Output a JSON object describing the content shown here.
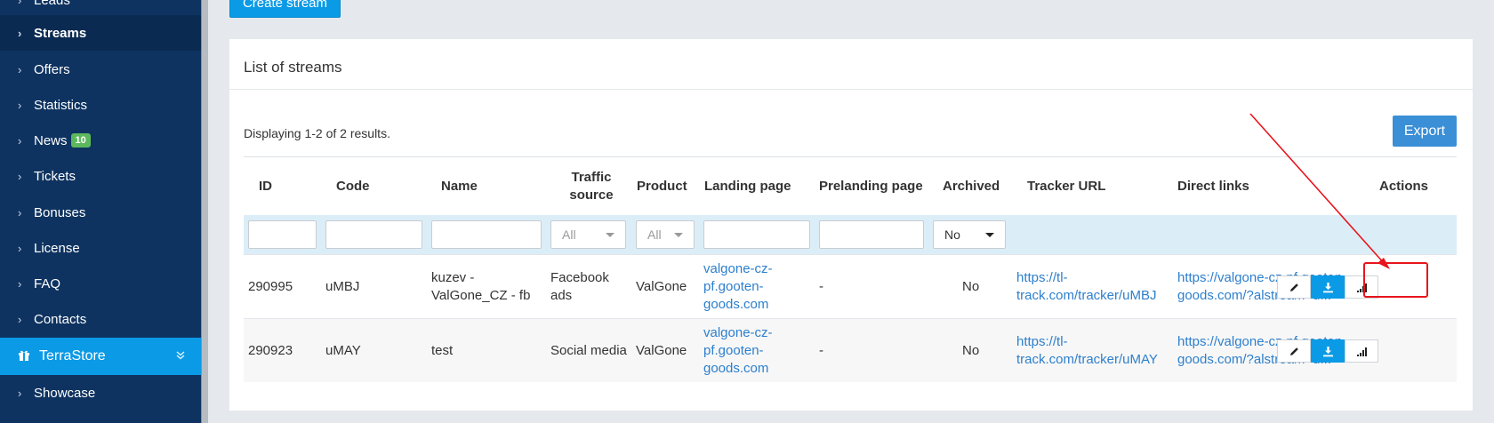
{
  "sidebar": {
    "items": [
      {
        "label": "Leads"
      },
      {
        "label": "Streams"
      },
      {
        "label": "Offers"
      },
      {
        "label": "Statistics"
      },
      {
        "label": "News",
        "badge": "10"
      },
      {
        "label": "Tickets"
      },
      {
        "label": "Bonuses"
      },
      {
        "label": "License"
      },
      {
        "label": "FAQ"
      },
      {
        "label": "Contacts"
      },
      {
        "label": "TerraStore"
      },
      {
        "label": "Showcase"
      }
    ]
  },
  "toolbar": {
    "create_label": "Create stream"
  },
  "panel": {
    "title": "List of streams",
    "summary": "Displaying 1-2 of 2 results.",
    "export_label": "Export"
  },
  "table": {
    "headers": {
      "id": "ID",
      "code": "Code",
      "name": "Name",
      "traffic_line1": "Traffic",
      "traffic_line2": "source",
      "product": "Product",
      "landing": "Landing page",
      "prelanding": "Prelanding page",
      "archived": "Archived",
      "tracker": "Tracker URL",
      "direct": "Direct links",
      "actions": "Actions"
    },
    "filters": {
      "traffic": "All",
      "product": "All",
      "archived": "No"
    },
    "rows": [
      {
        "id": "290995",
        "code": "uMBJ",
        "name_l1": "kuzev -",
        "name_l2": "ValGone_CZ - fb",
        "traffic_l1": "Facebook",
        "traffic_l2": "ads",
        "product": "ValGone",
        "landing_l1": "valgone-cz-",
        "landing_l2": "pf.gooten-",
        "landing_l3": "goods.com",
        "prelanding": "-",
        "archived": "No",
        "tracker_l1": "https://tl-",
        "tracker_l2": "track.com/tracker/uMBJ",
        "direct_l1": "https://valgone-cz-pf.gooten-",
        "direct_l2": "goods.com/?alstream=u..."
      },
      {
        "id": "290923",
        "code": "uMAY",
        "name_l1": "test",
        "traffic_l1": "Social media",
        "product": "ValGone",
        "landing_l1": "valgone-cz-",
        "landing_l2": "pf.gooten-",
        "landing_l3": "goods.com",
        "prelanding": "-",
        "archived": "No",
        "tracker_l1": "https://tl-",
        "tracker_l2": "track.com/tracker/uMAY",
        "direct_l1": "https://valgone-cz-pf.gooten-",
        "direct_l2": "goods.com/?alstream=u..."
      }
    ],
    "action_icons": [
      "pencil-icon",
      "download-icon",
      "signal-bars-icon"
    ]
  },
  "colors": {
    "sidebar_bg": "#0e3360",
    "accent": "#0b9ae6",
    "export_bg": "#3a8fd6",
    "link": "#2d7fcc",
    "badge": "#5cb85c",
    "annotation": "#e8141c"
  }
}
